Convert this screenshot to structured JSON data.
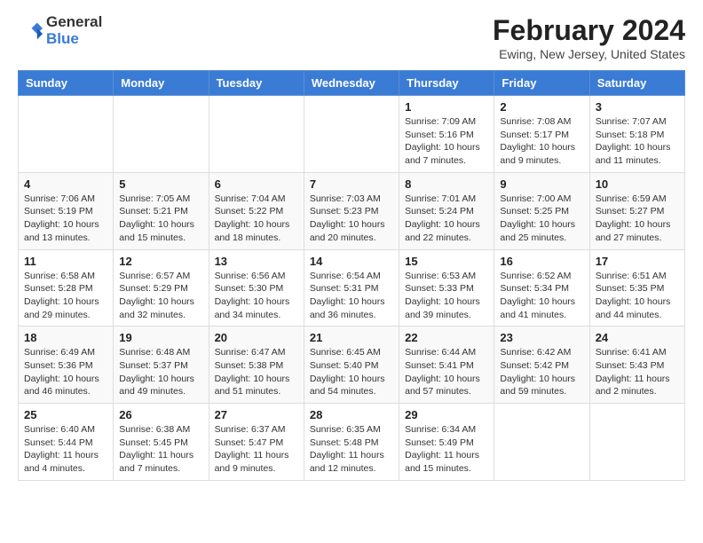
{
  "header": {
    "logo_general": "General",
    "logo_blue": "Blue",
    "month": "February 2024",
    "location": "Ewing, New Jersey, United States"
  },
  "weekdays": [
    "Sunday",
    "Monday",
    "Tuesday",
    "Wednesday",
    "Thursday",
    "Friday",
    "Saturday"
  ],
  "weeks": [
    [
      {
        "day": "",
        "info": ""
      },
      {
        "day": "",
        "info": ""
      },
      {
        "day": "",
        "info": ""
      },
      {
        "day": "",
        "info": ""
      },
      {
        "day": "1",
        "info": "Sunrise: 7:09 AM\nSunset: 5:16 PM\nDaylight: 10 hours and 7 minutes."
      },
      {
        "day": "2",
        "info": "Sunrise: 7:08 AM\nSunset: 5:17 PM\nDaylight: 10 hours and 9 minutes."
      },
      {
        "day": "3",
        "info": "Sunrise: 7:07 AM\nSunset: 5:18 PM\nDaylight: 10 hours and 11 minutes."
      }
    ],
    [
      {
        "day": "4",
        "info": "Sunrise: 7:06 AM\nSunset: 5:19 PM\nDaylight: 10 hours and 13 minutes."
      },
      {
        "day": "5",
        "info": "Sunrise: 7:05 AM\nSunset: 5:21 PM\nDaylight: 10 hours and 15 minutes."
      },
      {
        "day": "6",
        "info": "Sunrise: 7:04 AM\nSunset: 5:22 PM\nDaylight: 10 hours and 18 minutes."
      },
      {
        "day": "7",
        "info": "Sunrise: 7:03 AM\nSunset: 5:23 PM\nDaylight: 10 hours and 20 minutes."
      },
      {
        "day": "8",
        "info": "Sunrise: 7:01 AM\nSunset: 5:24 PM\nDaylight: 10 hours and 22 minutes."
      },
      {
        "day": "9",
        "info": "Sunrise: 7:00 AM\nSunset: 5:25 PM\nDaylight: 10 hours and 25 minutes."
      },
      {
        "day": "10",
        "info": "Sunrise: 6:59 AM\nSunset: 5:27 PM\nDaylight: 10 hours and 27 minutes."
      }
    ],
    [
      {
        "day": "11",
        "info": "Sunrise: 6:58 AM\nSunset: 5:28 PM\nDaylight: 10 hours and 29 minutes."
      },
      {
        "day": "12",
        "info": "Sunrise: 6:57 AM\nSunset: 5:29 PM\nDaylight: 10 hours and 32 minutes."
      },
      {
        "day": "13",
        "info": "Sunrise: 6:56 AM\nSunset: 5:30 PM\nDaylight: 10 hours and 34 minutes."
      },
      {
        "day": "14",
        "info": "Sunrise: 6:54 AM\nSunset: 5:31 PM\nDaylight: 10 hours and 36 minutes."
      },
      {
        "day": "15",
        "info": "Sunrise: 6:53 AM\nSunset: 5:33 PM\nDaylight: 10 hours and 39 minutes."
      },
      {
        "day": "16",
        "info": "Sunrise: 6:52 AM\nSunset: 5:34 PM\nDaylight: 10 hours and 41 minutes."
      },
      {
        "day": "17",
        "info": "Sunrise: 6:51 AM\nSunset: 5:35 PM\nDaylight: 10 hours and 44 minutes."
      }
    ],
    [
      {
        "day": "18",
        "info": "Sunrise: 6:49 AM\nSunset: 5:36 PM\nDaylight: 10 hours and 46 minutes."
      },
      {
        "day": "19",
        "info": "Sunrise: 6:48 AM\nSunset: 5:37 PM\nDaylight: 10 hours and 49 minutes."
      },
      {
        "day": "20",
        "info": "Sunrise: 6:47 AM\nSunset: 5:38 PM\nDaylight: 10 hours and 51 minutes."
      },
      {
        "day": "21",
        "info": "Sunrise: 6:45 AM\nSunset: 5:40 PM\nDaylight: 10 hours and 54 minutes."
      },
      {
        "day": "22",
        "info": "Sunrise: 6:44 AM\nSunset: 5:41 PM\nDaylight: 10 hours and 57 minutes."
      },
      {
        "day": "23",
        "info": "Sunrise: 6:42 AM\nSunset: 5:42 PM\nDaylight: 10 hours and 59 minutes."
      },
      {
        "day": "24",
        "info": "Sunrise: 6:41 AM\nSunset: 5:43 PM\nDaylight: 11 hours and 2 minutes."
      }
    ],
    [
      {
        "day": "25",
        "info": "Sunrise: 6:40 AM\nSunset: 5:44 PM\nDaylight: 11 hours and 4 minutes."
      },
      {
        "day": "26",
        "info": "Sunrise: 6:38 AM\nSunset: 5:45 PM\nDaylight: 11 hours and 7 minutes."
      },
      {
        "day": "27",
        "info": "Sunrise: 6:37 AM\nSunset: 5:47 PM\nDaylight: 11 hours and 9 minutes."
      },
      {
        "day": "28",
        "info": "Sunrise: 6:35 AM\nSunset: 5:48 PM\nDaylight: 11 hours and 12 minutes."
      },
      {
        "day": "29",
        "info": "Sunrise: 6:34 AM\nSunset: 5:49 PM\nDaylight: 11 hours and 15 minutes."
      },
      {
        "day": "",
        "info": ""
      },
      {
        "day": "",
        "info": ""
      }
    ]
  ]
}
